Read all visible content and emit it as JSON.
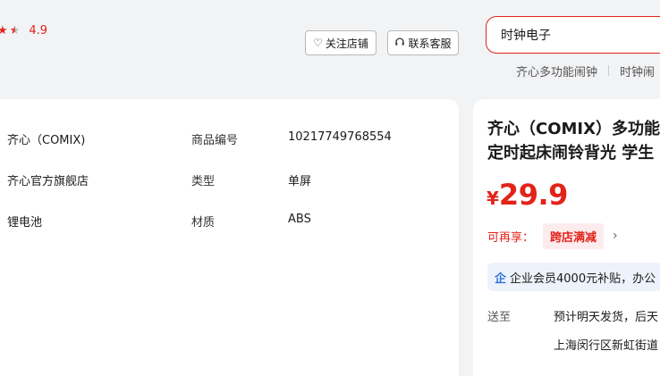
{
  "header": {
    "rating_value": "4.9",
    "follow_label": "关注店铺",
    "contact_label": "联系客服",
    "search_value": "时钟电子",
    "hotwords": [
      "齐心多功能闹钟",
      "时钟闹"
    ]
  },
  "specs": [
    {
      "value": "齐心（COMIX)"
    },
    {
      "value": "齐心官方旗舰店"
    },
    {
      "value": "锂电池"
    },
    {
      "label": "商品编号",
      "value": "10217749768554"
    },
    {
      "label": "类型",
      "value": "单屏"
    },
    {
      "label": "材质",
      "value": "ABS"
    }
  ],
  "product": {
    "title_line1": "齐心（COMIX）多功能",
    "title_line2": "定时起床闹铃背光 学生",
    "price_symbol": "¥",
    "price_value": "29.9",
    "promo_label": "可再享：",
    "promo_tag": "跨店满减",
    "enterprise_text": "企业会员4000元补贴，办公",
    "deliver_label": "送至",
    "deliver_text": "预计明天发货，后天",
    "deliver_addr": "上海闵行区新虹街道"
  },
  "icons": {
    "star": "star-icon",
    "heart": "heart-icon",
    "headset": "headset-icon",
    "enterprise": "enterprise-icon",
    "chevron": "chevron-right-icon"
  },
  "colors": {
    "accent": "#e2231a",
    "promo_bg": "#fdecee",
    "enterprise_bg": "#eef3fb",
    "enterprise_icon": "#2f6fe0"
  }
}
